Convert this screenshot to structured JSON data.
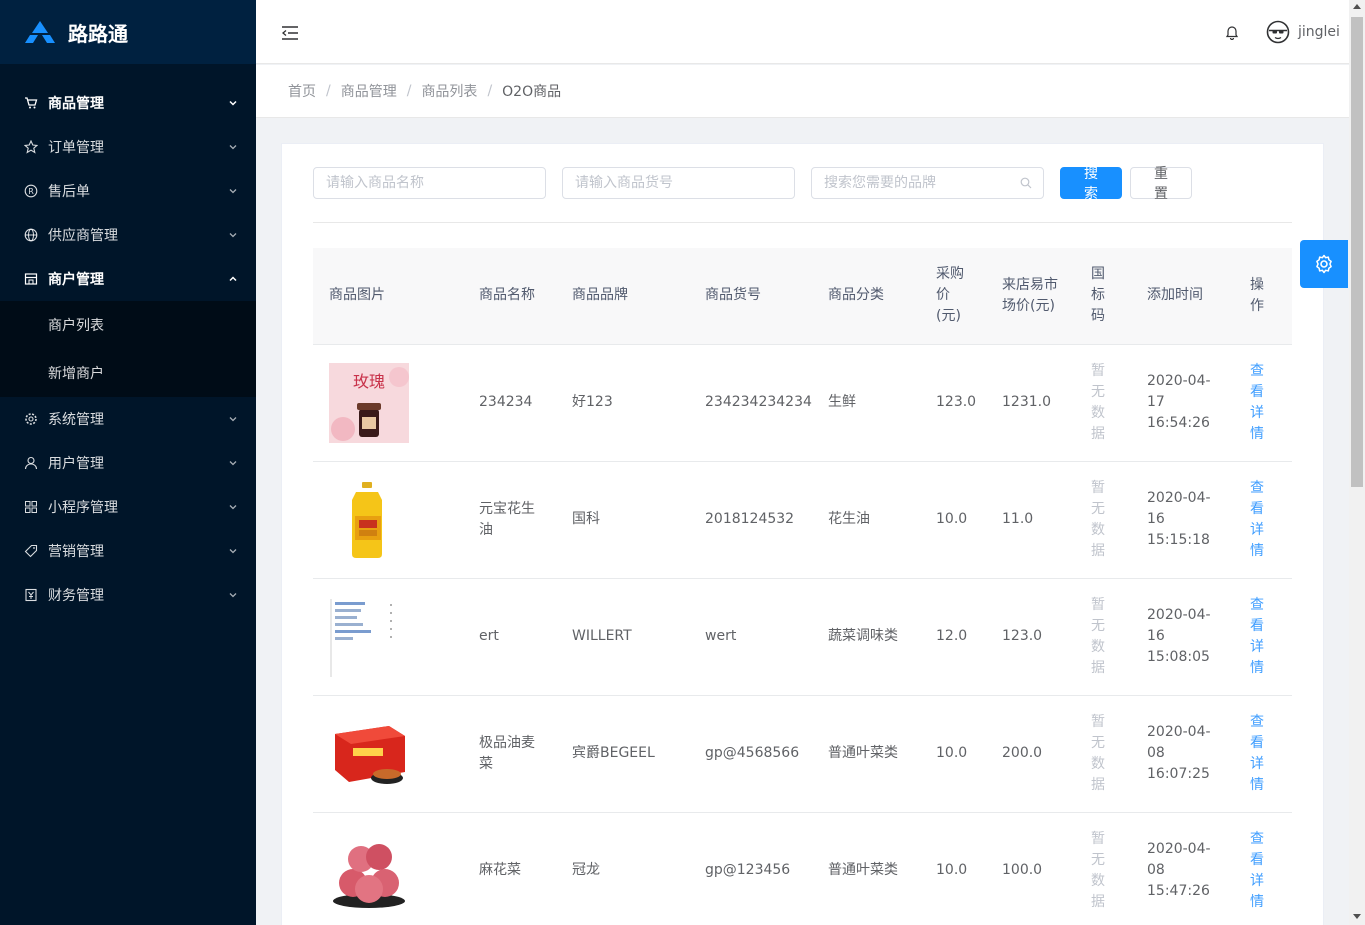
{
  "app": {
    "name": "路路通"
  },
  "sidebar": {
    "items": [
      {
        "label": "商品管理",
        "icon": "cart-icon",
        "open": true
      },
      {
        "label": "订单管理",
        "icon": "star-icon"
      },
      {
        "label": "售后单",
        "icon": "registered-icon"
      },
      {
        "label": "供应商管理",
        "icon": "globe-icon"
      },
      {
        "label": "商户管理",
        "icon": "shop-icon",
        "expanded": true
      },
      {
        "label": "系统管理",
        "icon": "gear-icon"
      },
      {
        "label": "用户管理",
        "icon": "user-icon"
      },
      {
        "label": "小程序管理",
        "icon": "grid-icon"
      },
      {
        "label": "营销管理",
        "icon": "tag-icon"
      },
      {
        "label": "财务管理",
        "icon": "finance-icon"
      }
    ],
    "subitems": [
      {
        "label": "商户列表"
      },
      {
        "label": "新增商户"
      }
    ]
  },
  "header": {
    "username": "jinglei"
  },
  "breadcrumb": [
    "首页",
    "商品管理",
    "商品列表",
    "O2O商品"
  ],
  "search": {
    "name_placeholder": "请输入商品名称",
    "sku_placeholder": "请输入商品货号",
    "brand_placeholder": "搜索您需要的品牌",
    "search_label": "搜 索",
    "reset_label": "重 置"
  },
  "table": {
    "columns": [
      "商品图片",
      "商品名称",
      "商品品牌",
      "商品货号",
      "商品分类",
      "采购价(元)",
      "来店易市场价(元)",
      "国标码",
      "添加时间",
      "操作"
    ],
    "rows": [
      {
        "image": "rose-jam-image",
        "name": "234234",
        "brand": "好123",
        "sku": "234234234234",
        "category": "生鲜",
        "price": "123.0",
        "market": "1231.0",
        "gb": "暂无数据",
        "time": "2020-04-17 16:54:26",
        "action": "查看详情"
      },
      {
        "image": "peanut-oil-image",
        "name": "元宝花生油",
        "brand": "国科",
        "sku": "2018124532",
        "category": "花生油",
        "price": "10.0",
        "market": "11.0",
        "gb": "暂无数据",
        "time": "2020-04-16 15:15:18",
        "action": "查看详情"
      },
      {
        "image": "screenshot-image",
        "name": "ert",
        "brand": "WILLERT",
        "sku": "wert",
        "category": "蔬菜调味类",
        "price": "12.0",
        "market": "123.0",
        "gb": "暂无数据",
        "time": "2020-04-16 15:08:05",
        "action": "查看详情"
      },
      {
        "image": "noodle-box-image",
        "name": "极品油麦菜",
        "brand": "宾爵BEGEEL",
        "sku": "gp@4568566",
        "category": "普通叶菜类",
        "price": "10.0",
        "market": "200.0",
        "gb": "暂无数据",
        "time": "2020-04-08 16:07:25",
        "action": "查看详情"
      },
      {
        "image": "peach-image",
        "name": "麻花菜",
        "brand": "冠龙",
        "sku": "gp@123456",
        "category": "普通叶菜类",
        "price": "10.0",
        "market": "100.0",
        "gb": "暂无数据",
        "time": "2020-04-08 15:47:26",
        "action": "查看详情"
      }
    ]
  },
  "colors": {
    "sidebar": "#001529",
    "primary": "#1890ff",
    "link": "#409eff"
  }
}
